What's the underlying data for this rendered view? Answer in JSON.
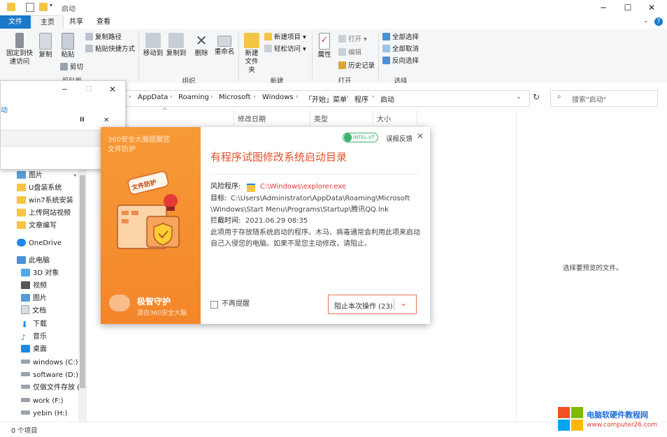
{
  "titlebar": {
    "title": "启动",
    "minimize": "─",
    "maximize": "☐",
    "close": "✕"
  },
  "tabs": {
    "file": "文件",
    "home": "主页",
    "share": "共享",
    "view": "查看"
  },
  "ribbon": {
    "pin_quick_access": "固定到快速访问",
    "copy": "复制",
    "paste": "粘贴",
    "copy_path": "复制路径",
    "paste_shortcut": "粘贴快捷方式",
    "cut": "剪切",
    "clipboard_group": "剪贴板",
    "move_to": "移动到",
    "copy_to": "复制到",
    "delete": "删除",
    "rename": "重命名",
    "organize_group": "组织",
    "new_folder": "新建文件夹",
    "new_item": "新建项目",
    "easy_access": "轻松访问",
    "new_group": "新建",
    "properties": "属性",
    "open": "打开",
    "edit": "编辑",
    "history": "历史记录",
    "open_group": "打开",
    "select_all": "全部选择",
    "select_none": "全部取消",
    "invert_selection": "反向选择",
    "select_group": "选择"
  },
  "address": {
    "crumbs": [
      "AppData",
      "Roaming",
      "Microsoft",
      "Windows",
      "「开始」菜单",
      "程序",
      "启动"
    ],
    "search_placeholder": "搜索\"启动\""
  },
  "columns": {
    "date": "修改日期",
    "type": "类型",
    "size": "大小"
  },
  "nav": {
    "items": [
      "图片",
      "U盘装系统",
      "win7系统安装",
      "上传网站视频",
      "文章编写",
      "OneDrive",
      "此电脑",
      "3D 对象",
      "视频",
      "图片",
      "文档",
      "下载",
      "音乐",
      "桌面",
      "windows (C:)",
      "software (D:)",
      "仅做文件存放 (E",
      "work (F:)",
      "yebin (H:)"
    ]
  },
  "minwin": {
    "text": "动",
    "pause": "II",
    "close": "✕"
  },
  "dialog": {
    "brand_line1": "360安全大脑提醒您",
    "brand_line2": "文件防护",
    "badge_text": "文件防护",
    "bottom_title": "极智守护",
    "bottom_sub": "源自360安全大脑",
    "tag": "INTEL-VT",
    "feedback": "误报反馈",
    "heading": "有程序试图修改系统启动目录",
    "risk_label": "风险程序:",
    "risk_value": "C:\\Windows\\explorer.exe",
    "target_label": "目标:",
    "target_value_1": "C:\\Users\\Administrator\\AppData\\Roaming\\Microsoft",
    "target_value_2": "\\Windows\\Start Menu\\Programs\\Startup\\腾讯QQ.lnk",
    "time_label": "拦截时间:",
    "time_value": "2021.06.29 08:35",
    "desc_1": "此项用于存放随系统启动的程序。木马、病毒通常会利用此项来启动",
    "desc_2": "自己入侵您的电脑。如果不是您主动修改，请阻止。",
    "no_remind": "不再提醒",
    "block_button": "阻止本次操作 (23)"
  },
  "preview_msg": "选择要预览的文件。",
  "status": {
    "count": "0 个项目"
  },
  "watermark": {
    "name": "电脑软硬件教程网",
    "url": "www.computer26.com"
  }
}
